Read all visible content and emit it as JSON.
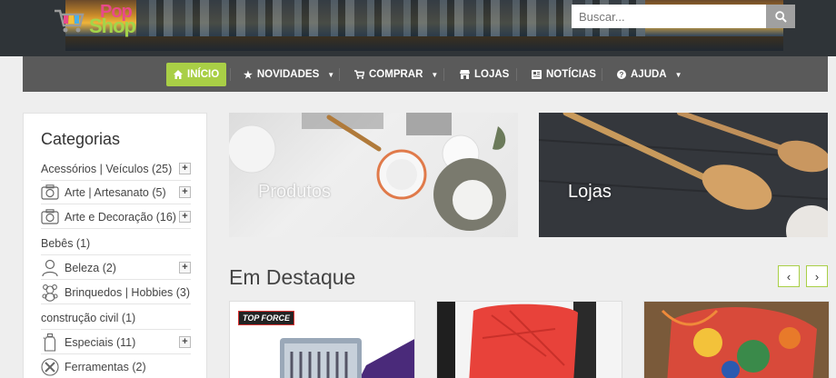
{
  "logo": {
    "top": "Pop",
    "bottom": "Shop"
  },
  "search": {
    "placeholder": "Buscar...",
    "icon": "search-icon"
  },
  "nav": [
    {
      "label": "INÍCIO",
      "icon": "home-icon",
      "active": true,
      "dropdown": false
    },
    {
      "label": "NOVIDADES",
      "icon": "star-icon",
      "active": false,
      "dropdown": true
    },
    {
      "label": "COMPRAR",
      "icon": "cart-icon",
      "active": false,
      "dropdown": true
    },
    {
      "label": "LOJAS",
      "icon": "store-icon",
      "active": false,
      "dropdown": false
    },
    {
      "label": "NOTÍCIAS",
      "icon": "newspaper-icon",
      "active": false,
      "dropdown": false
    },
    {
      "label": "AJUDA",
      "icon": "help-icon",
      "active": false,
      "dropdown": true
    }
  ],
  "sidebar": {
    "title": "Categorias",
    "items": [
      {
        "label": "Acessórios | Veículos (25)",
        "icon": null,
        "expandable": true
      },
      {
        "label": "Arte | Artesanato (5)",
        "icon": "camera-icon",
        "expandable": true
      },
      {
        "label": "Arte e Decoração (16)",
        "icon": "camera-icon",
        "expandable": true
      },
      {
        "label": "Bebês (1)",
        "icon": null,
        "expandable": false
      },
      {
        "label": "Beleza (2)",
        "icon": "person-icon",
        "expandable": true
      },
      {
        "label": "Brinquedos | Hobbies (3)",
        "icon": "teddy-bear-icon",
        "expandable": false
      },
      {
        "label": "construção civil (1)",
        "icon": null,
        "expandable": false
      },
      {
        "label": "Especiais (11)",
        "icon": "bottle-icon",
        "expandable": true
      },
      {
        "label": "Ferramentas (2)",
        "icon": "tools-icon",
        "expandable": false
      }
    ]
  },
  "promos": [
    {
      "label": "Produtos"
    },
    {
      "label": "Lojas"
    }
  ],
  "featured": {
    "title": "Em Destaque",
    "prev": "‹",
    "next": "›",
    "cards": [
      {
        "brand": "TOP FORCE"
      },
      {
        "brand": ""
      },
      {
        "brand": ""
      }
    ]
  },
  "colors": {
    "accent": "#a9cf46",
    "nav_bg": "#5a5a5a",
    "header_bg": "#2f3438"
  }
}
